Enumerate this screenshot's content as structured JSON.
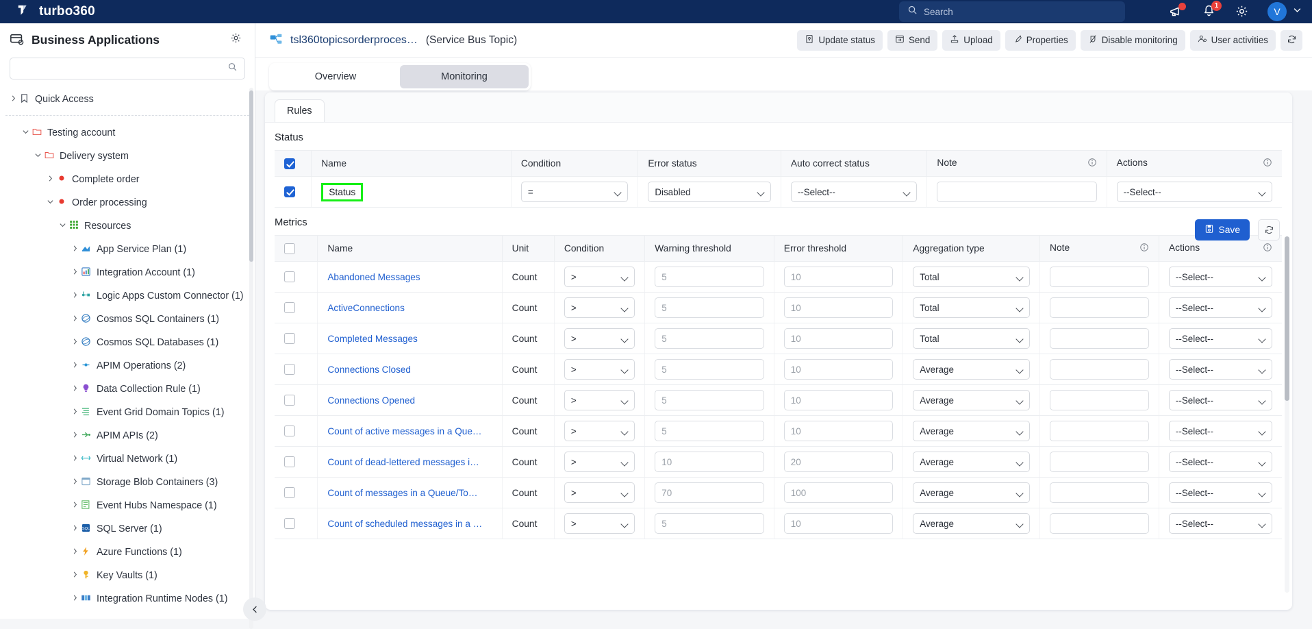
{
  "topbar": {
    "brand": "turbo360",
    "search_placeholder": "Search",
    "icons": {
      "announcement": "megaphone-icon",
      "notifications": "bell-icon",
      "notification_count": "1",
      "settings": "gear-icon",
      "avatar_initial": "V",
      "avatar_chevron": "chevron-down-icon"
    }
  },
  "sidebar": {
    "title": "Business Applications",
    "settings_icon": "gear-icon",
    "search_value": "",
    "search_placeholder": "",
    "items": [
      {
        "label": "Quick Access",
        "indent": 0,
        "expanded": false,
        "icon": "bookmark-icon",
        "icon_color": "#3d4450"
      },
      {
        "label": "Testing account",
        "indent": 1,
        "expanded": true,
        "icon": "folder-icon",
        "icon_color": "#e8534a"
      },
      {
        "label": "Delivery system",
        "indent": 2,
        "expanded": true,
        "icon": "folder-icon",
        "icon_color": "#e8534a"
      },
      {
        "label": "Complete order",
        "indent": 3,
        "expanded": false,
        "icon": "dot-icon",
        "icon_color": "#e8392f"
      },
      {
        "label": "Order processing",
        "indent": 3,
        "expanded": true,
        "icon": "dot-icon",
        "icon_color": "#e8392f"
      },
      {
        "label": "Resources",
        "indent": 4,
        "expanded": true,
        "icon": "grid-icon",
        "icon_color": "#3ea832"
      },
      {
        "label": "App Service Plan (1)",
        "indent": 5,
        "expanded": false,
        "icon": "app-service-plan-icon",
        "icon_color": "#2f8fd8"
      },
      {
        "label": "Integration Account (1)",
        "indent": 5,
        "expanded": false,
        "icon": "integration-account-icon",
        "icon_color": "#3b7ec7"
      },
      {
        "label": "Logic Apps Custom Connector (1)",
        "indent": 5,
        "expanded": false,
        "icon": "logic-apps-connector-icon",
        "icon_color": "#2fa3a3"
      },
      {
        "label": "Cosmos SQL Containers (1)",
        "indent": 5,
        "expanded": false,
        "icon": "cosmos-db-icon",
        "icon_color": "#3b82c4"
      },
      {
        "label": "Cosmos SQL Databases (1)",
        "indent": 5,
        "expanded": false,
        "icon": "cosmos-db-icon",
        "icon_color": "#3b82c4"
      },
      {
        "label": "APIM Operations (2)",
        "indent": 5,
        "expanded": false,
        "icon": "apim-operations-icon",
        "icon_color": "#2b96d6"
      },
      {
        "label": "Data Collection Rule (1)",
        "indent": 5,
        "expanded": false,
        "icon": "data-collection-rule-icon",
        "icon_color": "#8a4fd0"
      },
      {
        "label": "Event Grid Domain Topics (1)",
        "indent": 5,
        "expanded": false,
        "icon": "event-grid-topic-icon",
        "icon_color": "#3bb273"
      },
      {
        "label": "APIM APIs (2)",
        "indent": 5,
        "expanded": false,
        "icon": "apim-api-icon",
        "icon_color": "#3fa85a"
      },
      {
        "label": "Virtual Network (1)",
        "indent": 5,
        "expanded": false,
        "icon": "virtual-network-icon",
        "icon_color": "#35b7c4"
      },
      {
        "label": "Storage Blob Containers (3)",
        "indent": 5,
        "expanded": false,
        "icon": "storage-blob-icon",
        "icon_color": "#7fa8c9"
      },
      {
        "label": "Event Hubs Namespace (1)",
        "indent": 5,
        "expanded": false,
        "icon": "event-hubs-icon",
        "icon_color": "#59b85e"
      },
      {
        "label": "SQL Server (1)",
        "indent": 5,
        "expanded": false,
        "icon": "sql-server-icon",
        "icon_color": "#1d5fa8"
      },
      {
        "label": "Azure Functions (1)",
        "indent": 5,
        "expanded": false,
        "icon": "azure-functions-icon",
        "icon_color": "#f0a020"
      },
      {
        "label": "Key Vaults (1)",
        "indent": 5,
        "expanded": false,
        "icon": "key-vault-icon",
        "icon_color": "#f0b429"
      },
      {
        "label": "Integration Runtime Nodes (1)",
        "indent": 5,
        "expanded": false,
        "icon": "integration-runtime-icon",
        "icon_color": "#3b7ec7"
      }
    ],
    "collapse_icon": "chevron-left-icon"
  },
  "resource_header": {
    "icon": "service-bus-topic-icon",
    "name": "tsl360topicsorderproces…",
    "type": "(Service Bus Topic)",
    "actions": [
      {
        "label": "Update status",
        "icon": "update-status-icon"
      },
      {
        "label": "Send",
        "icon": "send-icon"
      },
      {
        "label": "Upload",
        "icon": "upload-icon"
      },
      {
        "label": "Properties",
        "icon": "properties-icon"
      },
      {
        "label": "Disable monitoring",
        "icon": "disable-monitoring-icon"
      },
      {
        "label": "User activities",
        "icon": "user-activities-icon"
      }
    ],
    "refresh_icon": "refresh-icon"
  },
  "tabs": [
    {
      "label": "Overview",
      "active": false
    },
    {
      "label": "Monitoring",
      "active": true
    }
  ],
  "panel": {
    "rules_tab": "Rules",
    "save_label": "Save",
    "save_icon": "save-icon",
    "refresh_icon": "refresh-icon",
    "status": {
      "section_title": "Status",
      "header_checkbox_checked": true,
      "columns": [
        "Name",
        "Condition",
        "Error status",
        "Auto correct status",
        "Note",
        "Actions"
      ],
      "info_columns": [
        "Note",
        "Actions"
      ],
      "rows": [
        {
          "checked": true,
          "name": "Status",
          "name_highlighted": true,
          "condition": "=",
          "error_status": "Disabled",
          "auto_correct_status": "--Select--",
          "note": "",
          "actions": "--Select--"
        }
      ]
    },
    "metrics": {
      "section_title": "Metrics",
      "header_checkbox_checked": false,
      "columns": [
        "Name",
        "Unit",
        "Condition",
        "Warning threshold",
        "Error threshold",
        "Aggregation type",
        "Note",
        "Actions"
      ],
      "info_columns": [
        "Note",
        "Actions"
      ],
      "rows": [
        {
          "checked": false,
          "name": "Abandoned Messages",
          "unit": "Count",
          "condition": ">",
          "warning": "5",
          "error": "10",
          "aggregation": "Total",
          "note": "",
          "actions": "--Select--"
        },
        {
          "checked": false,
          "name": "ActiveConnections",
          "unit": "Count",
          "condition": ">",
          "warning": "5",
          "error": "10",
          "aggregation": "Total",
          "note": "",
          "actions": "--Select--"
        },
        {
          "checked": false,
          "name": "Completed Messages",
          "unit": "Count",
          "condition": ">",
          "warning": "5",
          "error": "10",
          "aggregation": "Total",
          "note": "",
          "actions": "--Select--"
        },
        {
          "checked": false,
          "name": "Connections Closed",
          "unit": "Count",
          "condition": ">",
          "warning": "5",
          "error": "10",
          "aggregation": "Average",
          "note": "",
          "actions": "--Select--"
        },
        {
          "checked": false,
          "name": "Connections Opened",
          "unit": "Count",
          "condition": ">",
          "warning": "5",
          "error": "10",
          "aggregation": "Average",
          "note": "",
          "actions": "--Select--"
        },
        {
          "checked": false,
          "name": "Count of active messages in a Que…",
          "unit": "Count",
          "condition": ">",
          "warning": "5",
          "error": "10",
          "aggregation": "Average",
          "note": "",
          "actions": "--Select--"
        },
        {
          "checked": false,
          "name": "Count of dead-lettered messages i…",
          "unit": "Count",
          "condition": ">",
          "warning": "10",
          "error": "20",
          "aggregation": "Average",
          "note": "",
          "actions": "--Select--"
        },
        {
          "checked": false,
          "name": "Count of messages in a Queue/To…",
          "unit": "Count",
          "condition": ">",
          "warning": "70",
          "error": "100",
          "aggregation": "Average",
          "note": "",
          "actions": "--Select--"
        },
        {
          "checked": false,
          "name": "Count of scheduled messages in a …",
          "unit": "Count",
          "condition": ">",
          "warning": "5",
          "error": "10",
          "aggregation": "Average",
          "note": "",
          "actions": "--Select--"
        }
      ]
    }
  },
  "colors": {
    "topbar": "#0e2a5c",
    "accent": "#1f5fd0",
    "highlight": "#16ef16",
    "link": "#1f5fd0",
    "badge": "#e8413c"
  }
}
